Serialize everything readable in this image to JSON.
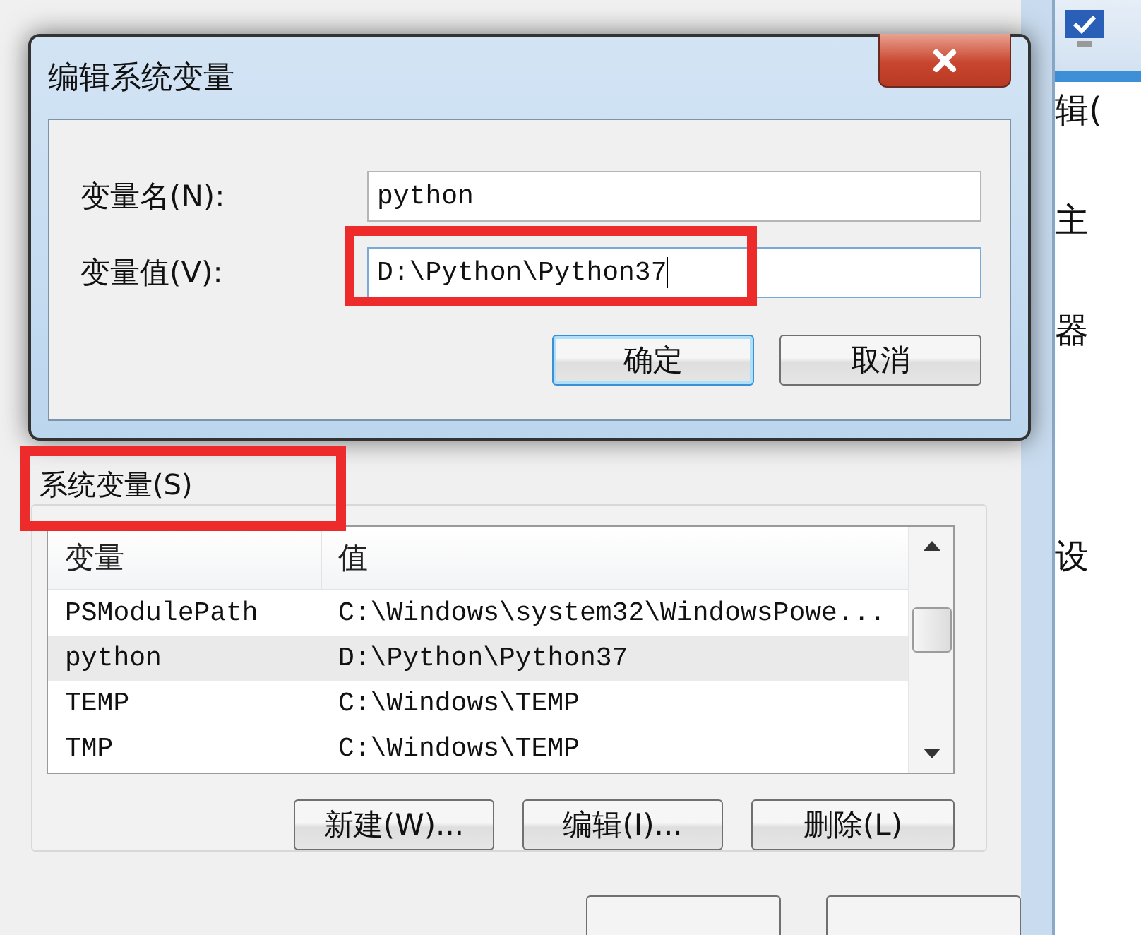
{
  "dialog": {
    "title": "编辑系统变量",
    "fields": [
      {
        "label": "变量名(N):",
        "value": "python",
        "focused": false
      },
      {
        "label": "变量值(V):",
        "value": "D:\\Python\\Python37",
        "focused": true
      }
    ],
    "buttons": [
      {
        "label": "确定",
        "default": true
      },
      {
        "label": "取消",
        "default": false
      }
    ]
  },
  "system_variables": {
    "title": "系统变量(S)",
    "columns": [
      "变量",
      "值"
    ],
    "rows": [
      {
        "name": "PSModulePath",
        "value": "C:\\Windows\\system32\\WindowsPowe...",
        "selected": false
      },
      {
        "name": "python",
        "value": "D:\\Python\\Python37",
        "selected": true
      },
      {
        "name": "TEMP",
        "value": "C:\\Windows\\TEMP",
        "selected": false
      },
      {
        "name": "TMP",
        "value": "C:\\Windows\\TEMP",
        "selected": false
      }
    ],
    "buttons": [
      "新建(W)...",
      "编辑(I)...",
      "删除(L)"
    ]
  },
  "side_window": {
    "texts": [
      "辑(",
      "主",
      "器",
      "设"
    ]
  }
}
